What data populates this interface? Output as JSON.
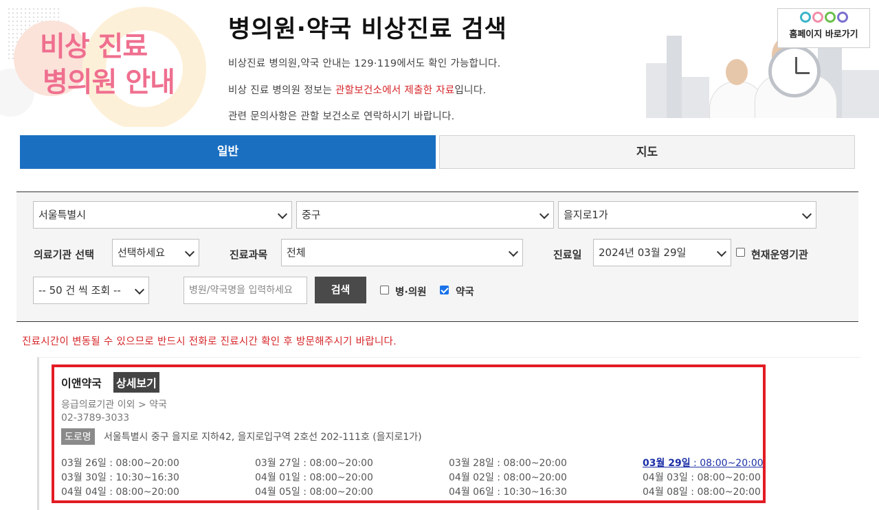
{
  "banner": {
    "left_title_line1": "비상 진료",
    "left_title_line2": "병의원 안내",
    "title": "병의원·약국 비상진료 검색",
    "info1": "비상진료 병의원,약국 안내는 129·119에서도 확인 가능합니다.",
    "info2_prefix": "비상 진료 병의원 정보는 ",
    "info2_highlight": "관할보건소에서 제출한 자료",
    "info2_suffix": "입니다.",
    "info3": "관련 문의사항은 관할 보건소로 연락하시기 바랍니다.",
    "home_link": "홈페이지 바로가기"
  },
  "tabs": {
    "general": "일반",
    "map": "지도"
  },
  "search": {
    "city": "서울특별시",
    "district": "중구",
    "dong": "을지로1가",
    "facility_label": "의료기관 선택",
    "facility_value": "선택하세요",
    "dept_label": "진료과목",
    "dept_value": "전체",
    "date_label": "진료일",
    "date_value": "2024년 03월 29일",
    "open_now_label": "현재운영기관",
    "open_now_checked": false,
    "page_size": "-- 50 건 씩 조회 --",
    "name_placeholder": "병원/약국명을 입력하세요",
    "search_button": "검색",
    "hospital_label": "병·의원",
    "hospital_checked": false,
    "pharmacy_label": "약국",
    "pharmacy_checked": true
  },
  "notice": "진료시간이 변동될 수 있으므로 반드시 전화로 진료시간 확인 후 방문해주시기 바랍니다.",
  "result": {
    "name": "이앤약국",
    "detail_button": "상세보기",
    "category": "응급의료기관 이외 > 약국",
    "phone": "02-3789-3033",
    "road_badge": "도로명",
    "address": "서울특별시 중구 을지로 지하42, 을지로입구역 2호선 202-111호 (을지로1가)",
    "schedule": [
      {
        "date": "03월 26일",
        "time": " : 08:00~20:00"
      },
      {
        "date": "03월 27일",
        "time": " : 08:00~20:00"
      },
      {
        "date": "03월 28일",
        "time": " : 08:00~20:00"
      },
      {
        "date": "03월 29일",
        "time": " : 08:00~20:00",
        "today": true
      },
      {
        "date": "03월 30일",
        "time": " : 10:30~16:30"
      },
      {
        "date": "04월 01일",
        "time": " : 08:00~20:00"
      },
      {
        "date": "04월 02일",
        "time": " : 08:00~20:00"
      },
      {
        "date": "04월 03일",
        "time": " : 08:00~20:00"
      },
      {
        "date": "04월 04일",
        "time": " : 08:00~20:00"
      },
      {
        "date": "04월 05일",
        "time": " : 08:00~20:00"
      },
      {
        "date": "04월 06일",
        "time": " : 10:30~16:30"
      },
      {
        "date": "04월 08일",
        "time": " : 08:00~20:00"
      }
    ]
  }
}
